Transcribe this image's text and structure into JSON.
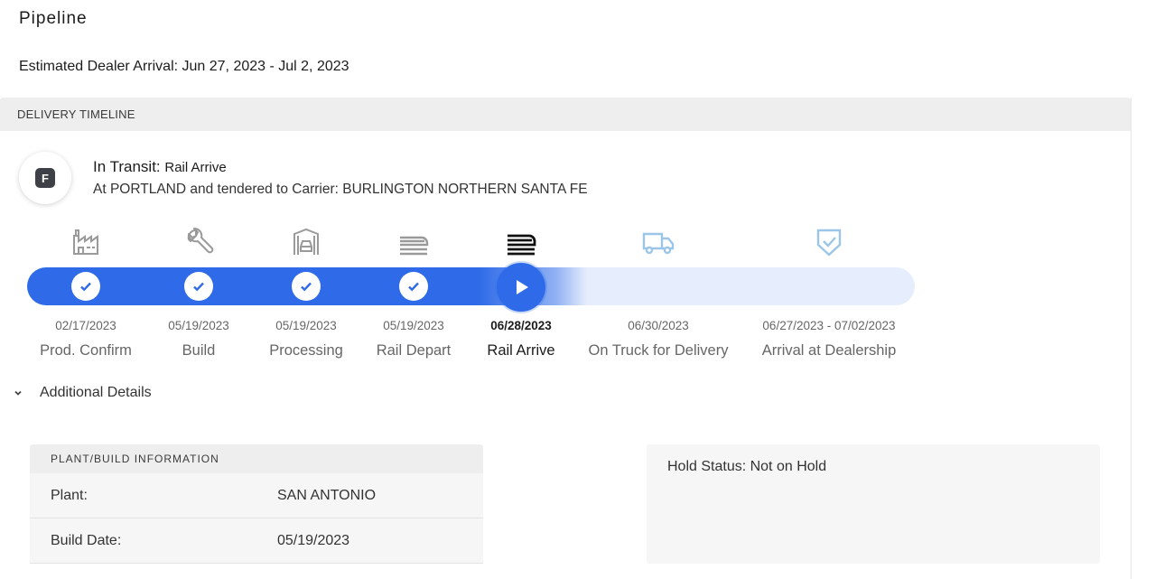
{
  "page": {
    "title": "Pipeline",
    "estimated_arrival": "Estimated Dealer Arrival: Jun 27, 2023 - Jul 2, 2023"
  },
  "timeline": {
    "header": "DELIVERY TIMELINE",
    "avatar_letter": "F",
    "status_prefix": "In Transit:",
    "status_value": "Rail Arrive",
    "status_detail": "At PORTLAND and tendered to Carrier: BURLINGTON NORTHERN SANTA FE",
    "stages": [
      {
        "icon": "factory-icon",
        "date": "02/17/2023",
        "label": "Prod. Confirm",
        "state": "complete"
      },
      {
        "icon": "wrench-icon",
        "date": "05/19/2023",
        "label": "Build",
        "state": "complete"
      },
      {
        "icon": "car-processing-icon",
        "date": "05/19/2023",
        "label": "Processing",
        "state": "complete"
      },
      {
        "icon": "rail-depart-icon",
        "date": "05/19/2023",
        "label": "Rail Depart",
        "state": "complete"
      },
      {
        "icon": "rail-arrive-icon",
        "date": "06/28/2023",
        "label": "Rail Arrive",
        "state": "current"
      },
      {
        "icon": "truck-icon",
        "date": "06/30/2023",
        "label": "On Truck for Delivery",
        "state": "upcoming"
      },
      {
        "icon": "shield-check-icon",
        "date": "06/27/2023 - 07/02/2023",
        "label": "Arrival at Dealership",
        "state": "upcoming"
      }
    ],
    "colors": {
      "progress": "#2f6be8",
      "track": "#e6edfc",
      "upcoming_icon": "#9cc6e8"
    }
  },
  "details": {
    "toggle_label": "Additional Details",
    "plant_section": {
      "header": "PLANT/BUILD INFORMATION",
      "rows": [
        {
          "key": "Plant:",
          "value": "SAN ANTONIO"
        },
        {
          "key": "Build Date:",
          "value": "05/19/2023"
        }
      ]
    },
    "hold_status": "Hold Status: Not on Hold"
  }
}
